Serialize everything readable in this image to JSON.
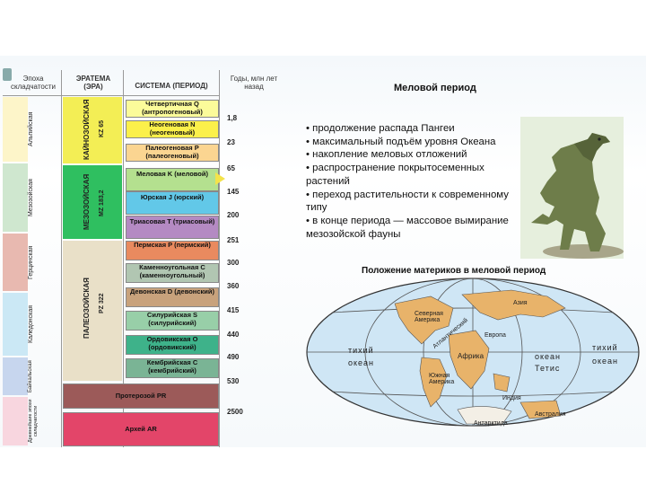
{
  "headers": {
    "eon": "Эпоха складчатости",
    "era": "ЭРАТЕМА (ЭРА)",
    "system": "СИСТЕМА (ПЕРИОД)",
    "years": "Годы, млн лет назад"
  },
  "folding_epochs": [
    {
      "label": "Альпийская",
      "color": "#fdf5c9"
    },
    {
      "label": "Мезозойская",
      "color": "#cfe7cf"
    },
    {
      "label": "Герцинская",
      "color": "#e8b9b0"
    },
    {
      "label": "Каледонская",
      "color": "#cbe8f5"
    },
    {
      "label": "Байкальская",
      "color": "#c7d6ee"
    },
    {
      "label": "Древнейшие эпохи складчатости",
      "color": "#f8d6df"
    }
  ],
  "eras": [
    {
      "name": "КАЙНОЗОЙСКАЯ",
      "code": "KZ 65",
      "color": "#f3ee55"
    },
    {
      "name": "МЕЗОЗОЙСКАЯ",
      "code": "MZ 183,2",
      "color": "#2fbf60"
    },
    {
      "name": "ПАЛЕОЗОЙСКАЯ",
      "code": "PZ 322",
      "color": "#e9e0c8"
    }
  ],
  "systems": [
    {
      "label": "Четвертичная Q (антропогеновый)",
      "color": "#fbfb9a"
    },
    {
      "label": "Неогеновая N (неогеновый)",
      "color": "#fbf04a"
    },
    {
      "label": "Палеогеновая P (палеогеновый)",
      "color": "#fbd591"
    },
    {
      "label": "Меловая K (меловой)",
      "color": "#b4e08f"
    },
    {
      "label": "Юрская J (юрский)",
      "color": "#62c8e8"
    },
    {
      "label": "Триасовая T (триасовый)",
      "color": "#b48ac3"
    },
    {
      "label": "Пермская P (пермский)",
      "color": "#e98a5f"
    },
    {
      "label": "Каменноугольная C (каменноугольный)",
      "color": "#b1c6b2"
    },
    {
      "label": "Девонская D (девонский)",
      "color": "#c8a27c"
    },
    {
      "label": "Силурийская S (силурийский)",
      "color": "#98cfa8"
    },
    {
      "label": "Ордовикская O (ордовикский)",
      "color": "#3eb28a"
    },
    {
      "label": "Кембрийская C (кембрийский)",
      "color": "#7ab495"
    },
    {
      "label": "Протерозой PR",
      "color": "#9c5a59"
    },
    {
      "label": "Архей AR",
      "color": "#e34569"
    }
  ],
  "ages": [
    "1,8",
    "23",
    "65",
    "145",
    "200",
    "251",
    "300",
    "360",
    "415",
    "440",
    "490",
    "530",
    "2500"
  ],
  "slide": {
    "title": "Меловой период",
    "facts": [
      "• продолжение распада Пангеи",
      "• максимальный подъём уровня Океана",
      "• накопление меловых отложений",
      "• распространение покрытосеменных растений",
      "• переход растительности к современному типу",
      "• в конце периода — массовое вымирание мезозойской фауны"
    ],
    "map_title": "Положение материков в меловой период",
    "map_labels": {
      "ocean_left_1": "тихий",
      "ocean_left_2": "океан",
      "ocean_right_1": "тихий",
      "ocean_right_2": "океан",
      "ocean_mid_1": "океан",
      "tethys": "Тетис",
      "north_america": "Северная Америка",
      "atlantic": "Атлантический",
      "asia": "Азия",
      "europe": "Европа",
      "africa": "Африка",
      "south_america": "Южная Америка",
      "india": "Индия",
      "australia": "Австралия",
      "antarctica": "Антарктида"
    }
  }
}
